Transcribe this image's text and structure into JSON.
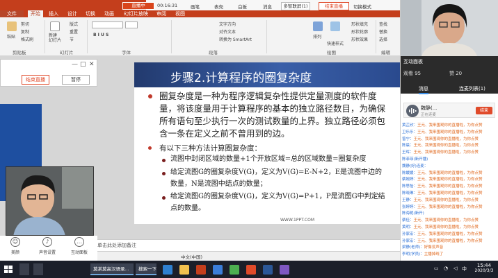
{
  "ppt": {
    "file_tab": "文件",
    "tabs": [
      "开始",
      "插入",
      "设计",
      "切换",
      "动画",
      "幻灯片放映",
      "审阅",
      "视图"
    ],
    "title_badge": "直播中",
    "toolbar_time": "00:16:31",
    "toolbar_items": [
      "画笔",
      "表壳",
      "白板",
      "消息"
    ],
    "multi_connect": "多智联屏(1)",
    "end_live": "结束直播",
    "switch_mode": "切换模式",
    "ribbon": {
      "groups": [
        "剪贴板",
        "幻灯片",
        "字体",
        "段落",
        "绘图",
        "编辑"
      ],
      "paste": "粘贴",
      "cut": "剪切",
      "copy": "复制",
      "format_painter": "格式刷",
      "new_slide": "新建\n幻灯片",
      "layout": "版式",
      "reset": "重置",
      "section": "节",
      "text_direction": "文字方向",
      "align_text": "对齐文本",
      "smartart": "转换为 SmartArt",
      "arrange": "排列",
      "quick_styles": "快速样式",
      "shape_fill": "形状填充",
      "shape_outline": "形状轮廓",
      "shape_effects": "形状效果",
      "find": "查找",
      "replace": "替换",
      "select": "选择"
    }
  },
  "float_bar": {
    "end_live": "结束直播",
    "pause": "暂停"
  },
  "slide": {
    "title": "步骤2.计算程序的圈复杂度",
    "para1": "圈复杂度是一种为程序逻辑复杂性提供定量测度的软件度量，将该度量用于计算程序的基本的独立路径数目，为确保所有语句至少执行一次的测试数量的上界。独立路径必须包含一条在定义之前不曾用到的边。",
    "para2": "有以下三种方法计算圈复杂度：",
    "sub1": "流图中封闭区域的数量+1个开放区域=总的区域数量=圈复杂度",
    "sub2a": "给定流图G的圈复杂度V(G)，定义为V(G)=E-N+2，E是流图中边的",
    "sub2b": "数量，N是流图中结点的数量；",
    "sub3a": "给定流图G的圈复杂度V(G)，定义为V(G)=P+1，P是流图G中判定结",
    "sub3b": "点的数量。",
    "url": "WWW.1PPT.COM"
  },
  "notes_placeholder": "单击此处添加备注",
  "status": {
    "lang": "中文(中国)"
  },
  "left_controls": [
    {
      "icon": "beauty-icon",
      "label": "美颜"
    },
    {
      "icon": "microphone-icon",
      "label": "声音设置"
    },
    {
      "icon": "chat-icon",
      "label": "互动面板"
    }
  ],
  "panel": {
    "title": "互动面板",
    "viewers": "观看 95",
    "likes": "赞 20",
    "tab_messages": "消息",
    "tab_mic": "连麦列表(1)",
    "voice_name": "魏静(...",
    "voice_sub": "正在连麦",
    "voice_button": "结束",
    "chat": [
      {
        "name": "黄芷欣：",
        "text": "王元、我来围观你的直播啦，为你点赞",
        "sys": false
      },
      {
        "name": "卫乐乐：",
        "text": "王元、我来围观你的直播啦，为你点赞",
        "sys": false
      },
      {
        "name": "曾宁：",
        "text": "王元、我来围观你的直播啦，为你点赞",
        "sys": false
      },
      {
        "name": "陈晨：",
        "text": "王元、我来围观你的直播啦，为你点赞",
        "sys": false
      },
      {
        "name": "王晖：",
        "text": "王元、我来围观你的直播啦，为你点赞",
        "sys": false
      },
      {
        "name": "陈菲菲(新开播)",
        "text": "",
        "sys": true
      },
      {
        "name": "魏静(好)连麦：",
        "text": "",
        "sys": true
      },
      {
        "name": "陈媛媛：",
        "text": "王元、我来围观你的直播啦，为你点赞",
        "sys": false
      },
      {
        "name": "蔡婉婷：",
        "text": "王元、我来围观你的直播啦，为你点赞",
        "sys": false
      },
      {
        "name": "陈思怡：",
        "text": "王元、我来围观你的直播啦，为你点赞",
        "sys": false
      },
      {
        "name": "陈晓琳：",
        "text": "王元、我来围观你的直播啦，为你点赞",
        "sys": false
      },
      {
        "name": "王静：",
        "text": "王元、我来围观你的直播啦，为你点赞",
        "sys": false
      },
      {
        "name": "张婷婷：",
        "text": "王元、我来围观你的直播啦，为你点赞",
        "sys": false
      },
      {
        "name": "陈海艳(新开)",
        "text": "",
        "sys": true
      },
      {
        "name": "蔡佳：",
        "text": "王元、我来围观你的直播啦，为你点赞",
        "sys": false
      },
      {
        "name": "黄明：",
        "text": "王元、我来围观你的直播啦，为你点赞",
        "sys": false
      },
      {
        "name": "孙家宏：",
        "text": "王元、我来围观你的直播啦，为你点赞",
        "sys": false
      },
      {
        "name": "孙家宏：",
        "text": "王元、我来围观你的直播啦，为你点赞",
        "sys": false
      },
      {
        "name": "梁静(老师)：",
        "text": "好像没声音",
        "sys": false
      },
      {
        "name": "李明(学员)：",
        "text": "主播掉线了",
        "sys": false
      }
    ]
  },
  "taskbar": {
    "items": [
      "莫某莫高汉语录...",
      "搜索一下"
    ],
    "time": "15:44",
    "date": "2020/3/3",
    "ime": "中"
  },
  "colors": {
    "ppt_red": "#c43e1c",
    "accent_blue": "#3b8fe8",
    "live_red": "#e04a2a"
  }
}
